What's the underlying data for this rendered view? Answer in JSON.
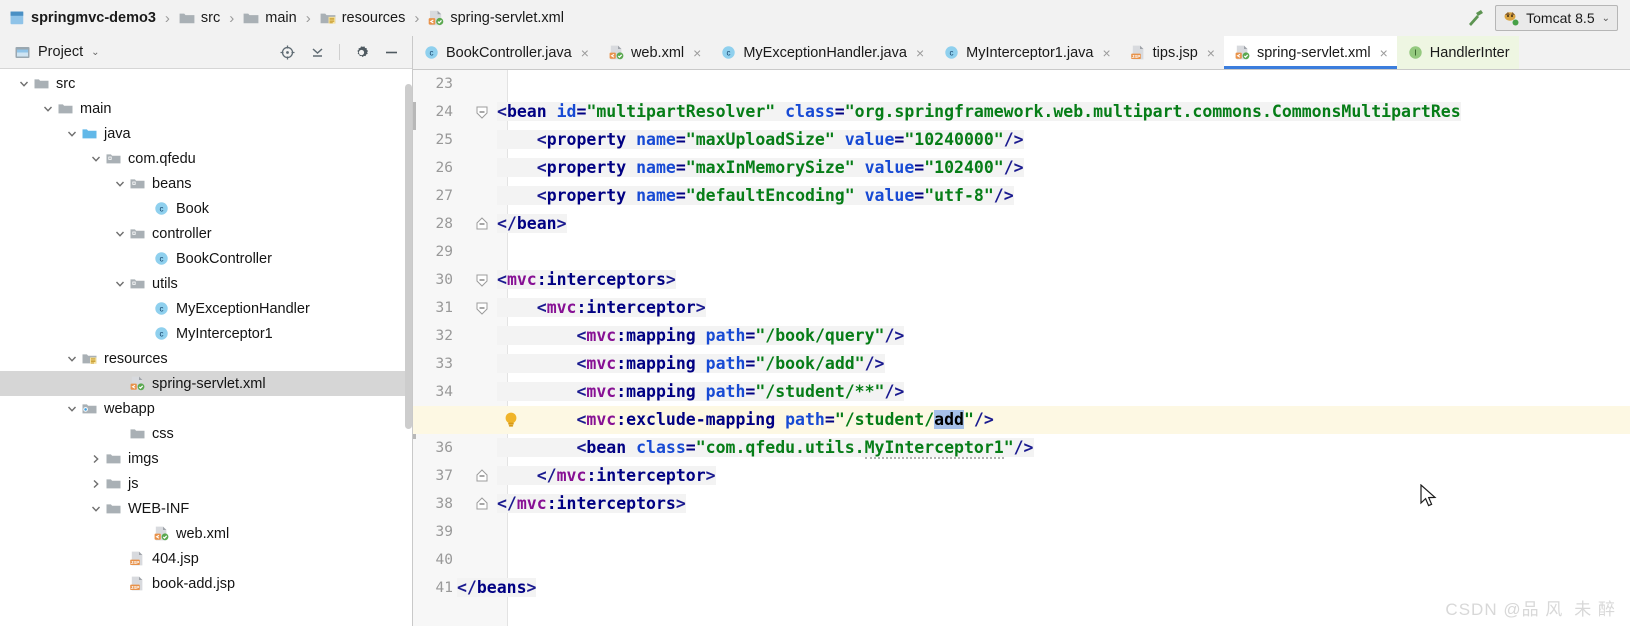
{
  "window": {
    "breadcrumb": [
      {
        "label": "springmvc-demo3",
        "icon": "module-icon"
      },
      {
        "label": "src",
        "icon": "folder-icon"
      },
      {
        "label": "main",
        "icon": "folder-icon"
      },
      {
        "label": "resources",
        "icon": "resources-folder-icon"
      },
      {
        "label": "spring-servlet.xml",
        "icon": "xml-file-icon"
      }
    ],
    "separator": "›",
    "run_config": {
      "label": "Tomcat 8.5",
      "icon": "tomcat-icon",
      "chevron": "⌄"
    },
    "build_icon": "hammer-icon"
  },
  "project_panel": {
    "title": "Project",
    "title_icon": "project-icon",
    "title_chevron": "⌄",
    "actions": [
      "locate-icon",
      "collapse-all-icon",
      "settings-gear-icon",
      "hide-icon"
    ],
    "tree": [
      {
        "label": "src",
        "indent": 1,
        "arrow": "down",
        "icon": "folder-icon",
        "selected": false
      },
      {
        "label": "main",
        "indent": 2,
        "arrow": "down",
        "icon": "folder-icon",
        "selected": false
      },
      {
        "label": "java",
        "indent": 3,
        "arrow": "down",
        "icon": "source-root-icon",
        "selected": false
      },
      {
        "label": "com.qfedu",
        "indent": 4,
        "arrow": "down",
        "icon": "package-icon",
        "selected": false
      },
      {
        "label": "beans",
        "indent": 5,
        "arrow": "down",
        "icon": "package-icon",
        "selected": false
      },
      {
        "label": "Book",
        "indent": 6,
        "arrow": "none",
        "icon": "class-icon",
        "selected": false
      },
      {
        "label": "controller",
        "indent": 5,
        "arrow": "down",
        "icon": "package-icon",
        "selected": false
      },
      {
        "label": "BookController",
        "indent": 6,
        "arrow": "none",
        "icon": "class-icon",
        "selected": false
      },
      {
        "label": "utils",
        "indent": 5,
        "arrow": "down",
        "icon": "package-icon",
        "selected": false
      },
      {
        "label": "MyExceptionHandler",
        "indent": 6,
        "arrow": "none",
        "icon": "class-icon",
        "selected": false
      },
      {
        "label": "MyInterceptor1",
        "indent": 6,
        "arrow": "none",
        "icon": "class-icon",
        "selected": false
      },
      {
        "label": "resources",
        "indent": 3,
        "arrow": "down",
        "icon": "resources-folder-icon",
        "selected": false
      },
      {
        "label": "spring-servlet.xml",
        "indent": 5,
        "arrow": "none",
        "icon": "xml-file-icon",
        "selected": true
      },
      {
        "label": "webapp",
        "indent": 3,
        "arrow": "down",
        "icon": "webapp-folder-icon",
        "selected": false
      },
      {
        "label": "css",
        "indent": 5,
        "arrow": "none",
        "icon": "folder-icon",
        "selected": false
      },
      {
        "label": "imgs",
        "indent": 4,
        "arrow": "right",
        "icon": "folder-icon",
        "selected": false
      },
      {
        "label": "js",
        "indent": 4,
        "arrow": "right",
        "icon": "folder-icon",
        "selected": false
      },
      {
        "label": "WEB-INF",
        "indent": 4,
        "arrow": "down",
        "icon": "folder-icon",
        "selected": false
      },
      {
        "label": "web.xml",
        "indent": 6,
        "arrow": "none",
        "icon": "xml-file-icon",
        "selected": false
      },
      {
        "label": "404.jsp",
        "indent": 5,
        "arrow": "none",
        "icon": "jsp-file-icon",
        "selected": false
      },
      {
        "label": "book-add.jsp",
        "indent": 5,
        "arrow": "none",
        "icon": "jsp-file-icon",
        "selected": false
      }
    ]
  },
  "editor": {
    "tabs": [
      {
        "label": "BookController.java",
        "icon": "class-icon",
        "active": false,
        "library": false,
        "close": "×"
      },
      {
        "label": "web.xml",
        "icon": "xml-file-icon",
        "active": false,
        "library": false,
        "close": "×"
      },
      {
        "label": "MyExceptionHandler.java",
        "icon": "class-icon",
        "active": false,
        "library": false,
        "close": "×"
      },
      {
        "label": "MyInterceptor1.java",
        "icon": "class-icon",
        "active": false,
        "library": false,
        "close": "×"
      },
      {
        "label": "tips.jsp",
        "icon": "jsp-file-icon",
        "active": false,
        "library": false,
        "close": "×"
      },
      {
        "label": "spring-servlet.xml",
        "icon": "xml-file-icon",
        "active": true,
        "library": false,
        "close": "×"
      },
      {
        "label": "HandlerInter",
        "icon": "interface-icon",
        "active": false,
        "library": true,
        "close": ""
      }
    ],
    "first_line": 23,
    "highlighted_line": 35,
    "bulb_line": 35,
    "lines": [
      {
        "n": 23,
        "fold": "none",
        "tokens": []
      },
      {
        "n": 24,
        "fold": "open",
        "tokens": [
          {
            "t": "punct",
            "s": "<"
          },
          {
            "t": "tag",
            "s": "bean"
          },
          {
            "t": "plain",
            "s": " "
          },
          {
            "t": "attr",
            "s": "id"
          },
          {
            "t": "eq",
            "s": "="
          },
          {
            "t": "val",
            "s": "\"multipartResolver\""
          },
          {
            "t": "plain",
            "s": " "
          },
          {
            "t": "attr",
            "s": "class"
          },
          {
            "t": "eq",
            "s": "="
          },
          {
            "t": "val",
            "s": "\"org.springframework.web.multipart.commons.CommonsMultipartRes"
          }
        ]
      },
      {
        "n": 25,
        "fold": "none",
        "tokens": [
          {
            "t": "plain",
            "s": "    "
          },
          {
            "t": "punct",
            "s": "<"
          },
          {
            "t": "tag",
            "s": "property"
          },
          {
            "t": "plain",
            "s": " "
          },
          {
            "t": "attr",
            "s": "name"
          },
          {
            "t": "eq",
            "s": "="
          },
          {
            "t": "val",
            "s": "\"maxUploadSize\""
          },
          {
            "t": "plain",
            "s": " "
          },
          {
            "t": "attr",
            "s": "value"
          },
          {
            "t": "eq",
            "s": "="
          },
          {
            "t": "val",
            "s": "\"10240000\""
          },
          {
            "t": "punct",
            "s": "/>"
          }
        ]
      },
      {
        "n": 26,
        "fold": "none",
        "tokens": [
          {
            "t": "plain",
            "s": "    "
          },
          {
            "t": "punct",
            "s": "<"
          },
          {
            "t": "tag",
            "s": "property"
          },
          {
            "t": "plain",
            "s": " "
          },
          {
            "t": "attr",
            "s": "name"
          },
          {
            "t": "eq",
            "s": "="
          },
          {
            "t": "val",
            "s": "\"maxInMemorySize\""
          },
          {
            "t": "plain",
            "s": " "
          },
          {
            "t": "attr",
            "s": "value"
          },
          {
            "t": "eq",
            "s": "="
          },
          {
            "t": "val",
            "s": "\"102400\""
          },
          {
            "t": "punct",
            "s": "/>"
          }
        ]
      },
      {
        "n": 27,
        "fold": "none",
        "tokens": [
          {
            "t": "plain",
            "s": "    "
          },
          {
            "t": "punct",
            "s": "<"
          },
          {
            "t": "tag",
            "s": "property"
          },
          {
            "t": "plain",
            "s": " "
          },
          {
            "t": "attr",
            "s": "name"
          },
          {
            "t": "eq",
            "s": "="
          },
          {
            "t": "val",
            "s": "\"defaultEncoding\""
          },
          {
            "t": "plain",
            "s": " "
          },
          {
            "t": "attr",
            "s": "value"
          },
          {
            "t": "eq",
            "s": "="
          },
          {
            "t": "val",
            "s": "\"utf-8\""
          },
          {
            "t": "punct",
            "s": "/>"
          }
        ]
      },
      {
        "n": 28,
        "fold": "close",
        "tokens": [
          {
            "t": "punct",
            "s": "</"
          },
          {
            "t": "tag",
            "s": "bean"
          },
          {
            "t": "punct",
            "s": ">"
          }
        ]
      },
      {
        "n": 29,
        "fold": "none",
        "tokens": []
      },
      {
        "n": 30,
        "fold": "open",
        "tokens": [
          {
            "t": "punct",
            "s": "<"
          },
          {
            "t": "ns",
            "s": "mvc"
          },
          {
            "t": "tag",
            "s": ":interceptors"
          },
          {
            "t": "punct",
            "s": ">"
          }
        ]
      },
      {
        "n": 31,
        "fold": "open",
        "tokens": [
          {
            "t": "plain",
            "s": "    "
          },
          {
            "t": "punct",
            "s": "<"
          },
          {
            "t": "ns",
            "s": "mvc"
          },
          {
            "t": "tag",
            "s": ":interceptor"
          },
          {
            "t": "punct",
            "s": ">"
          }
        ]
      },
      {
        "n": 32,
        "fold": "none",
        "tokens": [
          {
            "t": "plain",
            "s": "        "
          },
          {
            "t": "punct",
            "s": "<"
          },
          {
            "t": "ns",
            "s": "mvc"
          },
          {
            "t": "tag",
            "s": ":mapping"
          },
          {
            "t": "plain",
            "s": " "
          },
          {
            "t": "attr",
            "s": "path"
          },
          {
            "t": "eq",
            "s": "="
          },
          {
            "t": "val",
            "s": "\"/book/query\""
          },
          {
            "t": "punct",
            "s": "/>"
          }
        ]
      },
      {
        "n": 33,
        "fold": "none",
        "tokens": [
          {
            "t": "plain",
            "s": "        "
          },
          {
            "t": "punct",
            "s": "<"
          },
          {
            "t": "ns",
            "s": "mvc"
          },
          {
            "t": "tag",
            "s": ":mapping"
          },
          {
            "t": "plain",
            "s": " "
          },
          {
            "t": "attr",
            "s": "path"
          },
          {
            "t": "eq",
            "s": "="
          },
          {
            "t": "val",
            "s": "\"/book/add\""
          },
          {
            "t": "punct",
            "s": "/>"
          }
        ]
      },
      {
        "n": 34,
        "fold": "none",
        "tokens": [
          {
            "t": "plain",
            "s": "        "
          },
          {
            "t": "punct",
            "s": "<"
          },
          {
            "t": "ns",
            "s": "mvc"
          },
          {
            "t": "tag",
            "s": ":mapping"
          },
          {
            "t": "plain",
            "s": " "
          },
          {
            "t": "attr",
            "s": "path"
          },
          {
            "t": "eq",
            "s": "="
          },
          {
            "t": "val",
            "s": "\"/student/**\""
          },
          {
            "t": "punct",
            "s": "/>"
          }
        ]
      },
      {
        "n": 35,
        "fold": "none",
        "tokens": [
          {
            "t": "plain",
            "s": "        "
          },
          {
            "t": "punct",
            "s": "<"
          },
          {
            "t": "ns",
            "s": "mvc"
          },
          {
            "t": "tag",
            "s": ":exclude-mapping"
          },
          {
            "t": "plain",
            "s": " "
          },
          {
            "t": "attr",
            "s": "path"
          },
          {
            "t": "eq",
            "s": "="
          },
          {
            "t": "val",
            "s": "\"/student/"
          },
          {
            "t": "sel",
            "s": "add"
          },
          {
            "t": "val",
            "s": "\""
          },
          {
            "t": "punct",
            "s": "/>"
          }
        ]
      },
      {
        "n": 36,
        "fold": "none",
        "tokens": [
          {
            "t": "plain",
            "s": "        "
          },
          {
            "t": "punct",
            "s": "<"
          },
          {
            "t": "tag",
            "s": "bean"
          },
          {
            "t": "plain",
            "s": " "
          },
          {
            "t": "attr",
            "s": "class"
          },
          {
            "t": "eq",
            "s": "="
          },
          {
            "t": "val",
            "s": "\"com.qfedu.utils."
          },
          {
            "t": "val-warn",
            "s": "MyInterceptor1"
          },
          {
            "t": "val",
            "s": "\""
          },
          {
            "t": "punct",
            "s": "/>"
          }
        ]
      },
      {
        "n": 37,
        "fold": "close",
        "tokens": [
          {
            "t": "plain",
            "s": "    "
          },
          {
            "t": "punct",
            "s": "</"
          },
          {
            "t": "ns",
            "s": "mvc"
          },
          {
            "t": "tag",
            "s": ":interceptor"
          },
          {
            "t": "punct",
            "s": ">"
          }
        ]
      },
      {
        "n": 38,
        "fold": "close",
        "tokens": [
          {
            "t": "punct",
            "s": "</"
          },
          {
            "t": "ns",
            "s": "mvc"
          },
          {
            "t": "tag",
            "s": ":interceptors"
          },
          {
            "t": "punct",
            "s": ">"
          }
        ]
      },
      {
        "n": 39,
        "fold": "none",
        "tokens": []
      },
      {
        "n": 40,
        "fold": "none",
        "tokens": []
      },
      {
        "n": 41,
        "fold": "close",
        "tokens": [
          {
            "t": "punct",
            "s": "</"
          },
          {
            "t": "tag",
            "s": "beans"
          },
          {
            "t": "punct",
            "s": ">"
          }
        ],
        "outdent": true
      }
    ]
  },
  "watermark": "CSDN @品 风  未 醉",
  "colors": {
    "accent": "#3b7ddd",
    "tag": "#000083",
    "namespace": "#871094",
    "attribute": "#174ad4",
    "value": "#067d17",
    "selection": "#a6c0e8",
    "highlight_line": "#fdf8e3",
    "tree_selected": "#d6d6d6",
    "library_tab": "#eef6e2"
  }
}
